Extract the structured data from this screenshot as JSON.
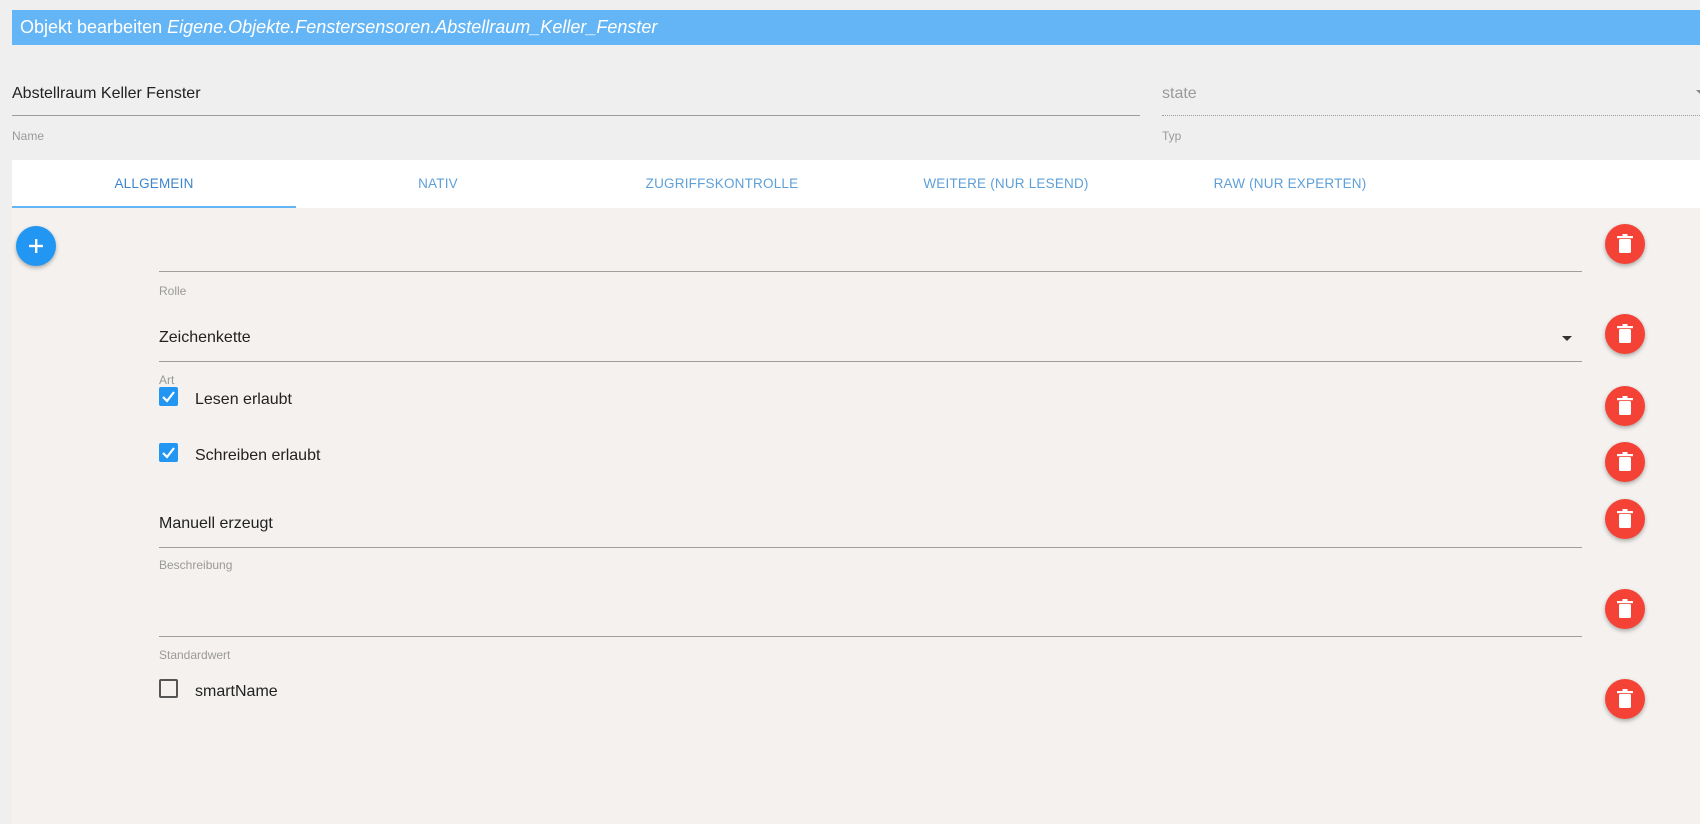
{
  "header": {
    "title_prefix": "Objekt bearbeiten",
    "object_id": "Eigene.Objekte.Fenstersensoren.Abstellraum_Keller_Fenster"
  },
  "name_field": {
    "value": "Abstellraum Keller Fenster",
    "label": "Name"
  },
  "type_field": {
    "value": "state",
    "label": "Typ"
  },
  "tabs": [
    {
      "label": "ALLGEMEIN",
      "active": true
    },
    {
      "label": "NATIV",
      "active": false
    },
    {
      "label": "ZUGRIFFSKONTROLLE",
      "active": false
    },
    {
      "label": "WEITERE (NUR LESEND)",
      "active": false
    },
    {
      "label": "RAW (NUR EXPERTEN)",
      "active": false
    }
  ],
  "fields": {
    "role": {
      "value": "",
      "label": "Rolle"
    },
    "type": {
      "value": "Zeichenkette",
      "label": "Art"
    },
    "read": {
      "label": "Lesen erlaubt",
      "checked": true
    },
    "write": {
      "label": "Schreiben erlaubt",
      "checked": true
    },
    "description": {
      "value": "Manuell erzeugt",
      "label": "Beschreibung"
    },
    "default": {
      "value": "",
      "label": "Standardwert"
    },
    "smartname": {
      "label": "smartName",
      "checked": false
    }
  },
  "colors": {
    "primary": "#2196f3",
    "title_bar": "#64b5f6",
    "delete": "#f44336"
  },
  "icons": {
    "add": "plus-icon",
    "delete": "trash-icon",
    "check": "check-icon",
    "dropdown": "caret-down-icon"
  }
}
